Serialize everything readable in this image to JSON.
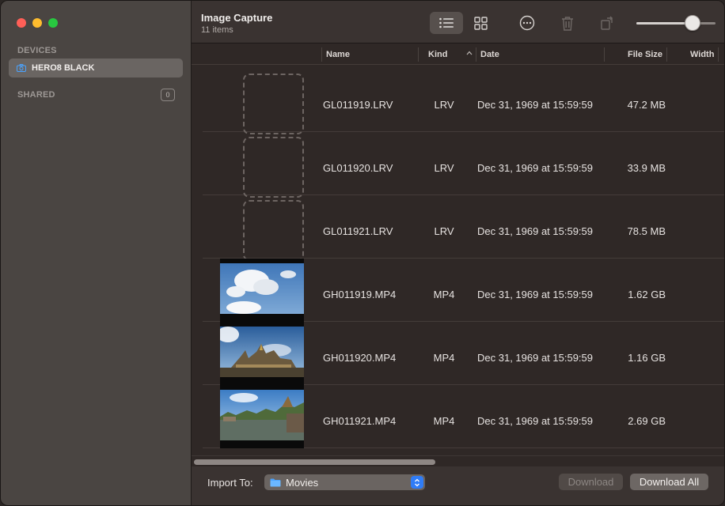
{
  "sidebar": {
    "devices_heading": "DEVICES",
    "device_name": "HERO8 BLACK",
    "shared_heading": "SHARED",
    "shared_count": "0"
  },
  "toolbar": {
    "title": "Image Capture",
    "subtitle": "11 items",
    "view_mode": "list",
    "thumbnail_size": 0.75,
    "icons": [
      "list-view-icon",
      "grid-view-icon",
      "more-icon",
      "trash-icon",
      "rotate-icon"
    ]
  },
  "table": {
    "columns": [
      "Name",
      "Kind",
      "Date",
      "File Size",
      "Width"
    ],
    "sort_column": "Kind",
    "sort_direction": "ascending",
    "rows": [
      {
        "name": "GL011919.LRV",
        "kind": "LRV",
        "date": "Dec 31, 1969 at 15:59:59",
        "size": "47.2 MB",
        "thumb": "placeholder"
      },
      {
        "name": "GL011920.LRV",
        "kind": "LRV",
        "date": "Dec 31, 1969 at 15:59:59",
        "size": "33.9 MB",
        "thumb": "placeholder"
      },
      {
        "name": "GL011921.LRV",
        "kind": "LRV",
        "date": "Dec 31, 1969 at 15:59:59",
        "size": "78.5 MB",
        "thumb": "placeholder"
      },
      {
        "name": "GH011919.MP4",
        "kind": "MP4",
        "date": "Dec 31, 1969 at 15:59:59",
        "size": "1.62 GB",
        "thumb": "sky"
      },
      {
        "name": "GH011920.MP4",
        "kind": "MP4",
        "date": "Dec 31, 1969 at 15:59:59",
        "size": "1.16 GB",
        "thumb": "palace"
      },
      {
        "name": "GH011921.MP4",
        "kind": "MP4",
        "date": "Dec 31, 1969 at 15:59:59",
        "size": "2.69 GB",
        "thumb": "canal"
      }
    ]
  },
  "bottom": {
    "import_label": "Import To:",
    "import_destination": "Movies",
    "download_label": "Download",
    "download_all_label": "Download All"
  },
  "colors": {
    "close": "#ff5f57",
    "minimize": "#febc2e",
    "zoom": "#28c840",
    "accent": "#2f7cf6"
  }
}
